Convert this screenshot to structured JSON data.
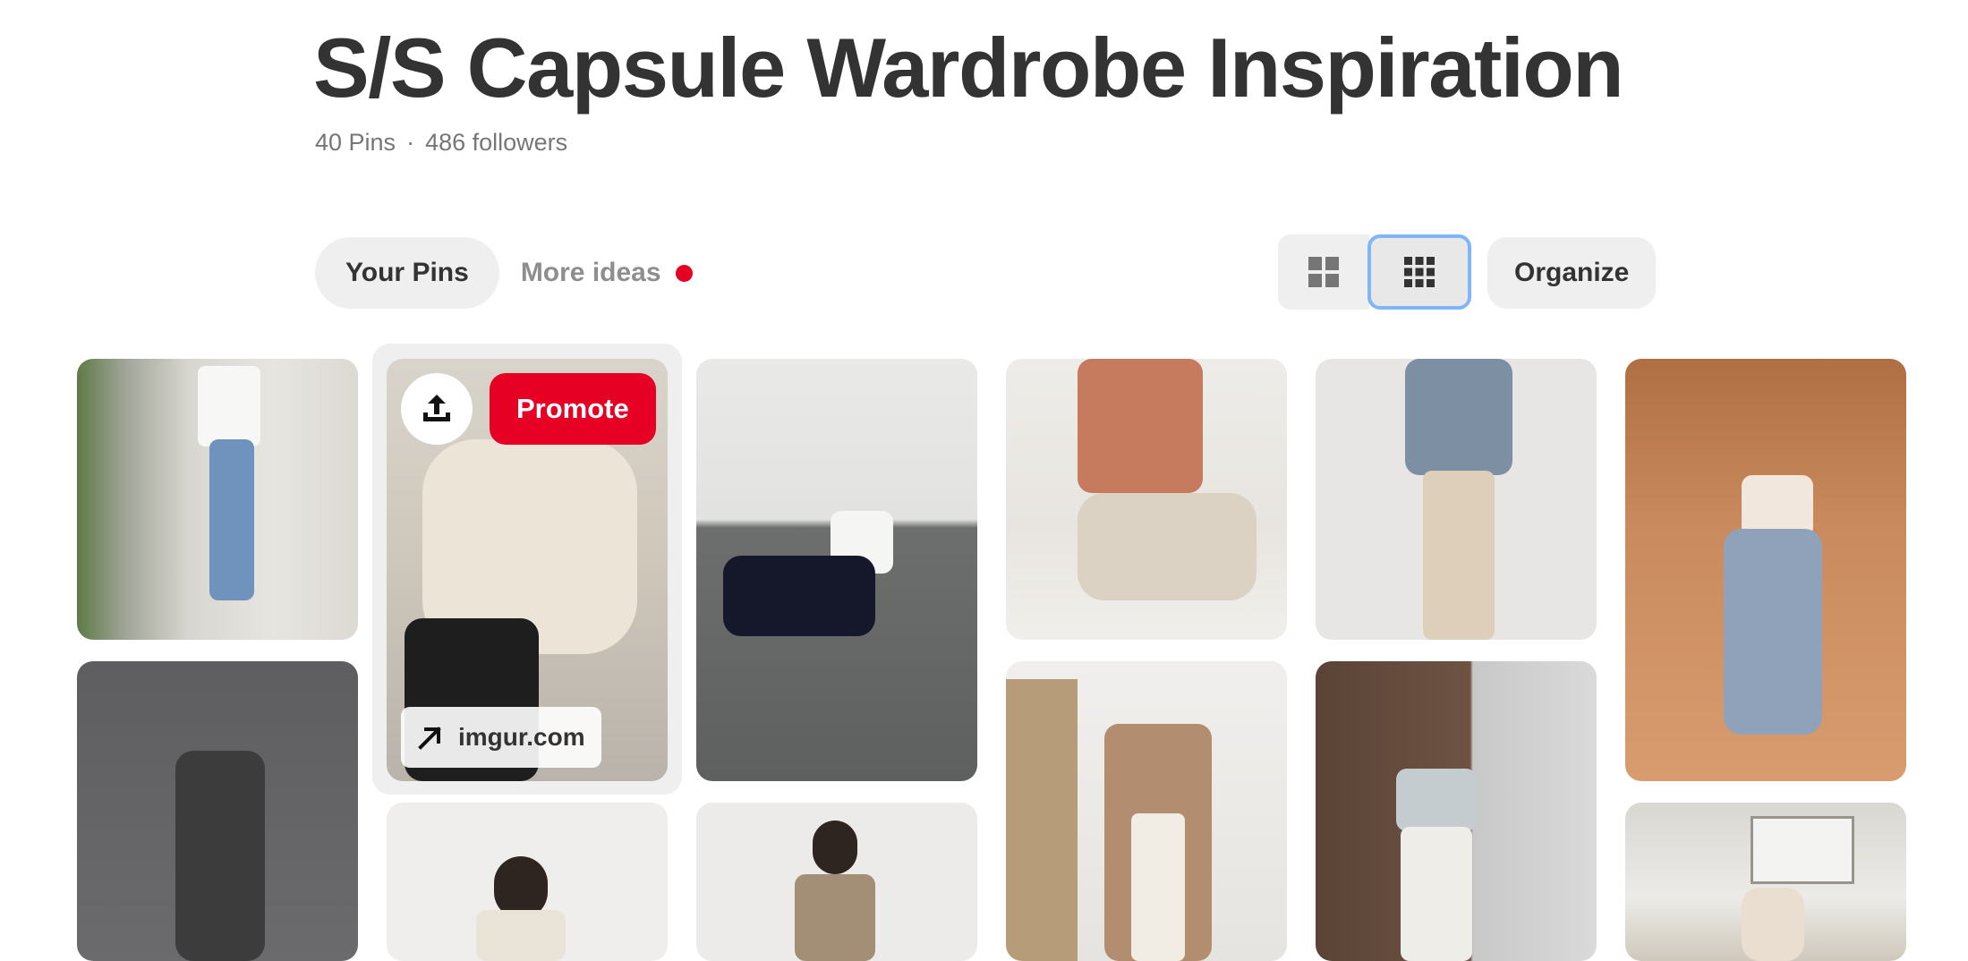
{
  "board": {
    "title": "S/S Capsule Wardrobe Inspiration",
    "pins_count": "40 Pins",
    "separator": "·",
    "followers": "486 followers"
  },
  "tabs": {
    "your_pins": "Your Pins",
    "more_ideas": "More ideas"
  },
  "toolbar": {
    "view_default_icon": "grid-2x2-icon",
    "view_compact_icon": "grid-3x3-icon",
    "organize_label": "Organize"
  },
  "pin_overlay": {
    "share_icon": "upload-icon",
    "promote_label": "Promote",
    "link_icon": "arrow-up-right-icon",
    "link_domain": "imgur.com"
  },
  "colors": {
    "accent_red": "#e60023",
    "selected_outline": "#7fb6f5",
    "chip_background": "#efefef"
  }
}
